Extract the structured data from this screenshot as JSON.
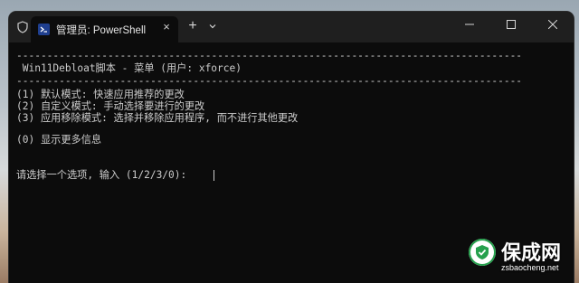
{
  "tab": {
    "title": "管理员: PowerShell",
    "close_icon": "×",
    "new_tab_icon": "+",
    "icon": "powershell-icon"
  },
  "window_controls": [
    "minimize-icon",
    "maximize-icon",
    "close-icon"
  ],
  "terminal": {
    "divider": "-----------------------------------------------------------------------------------",
    "menu_title": " Win11Debloat脚本 - 菜单 (用户: xforce)",
    "options": [
      "(1) 默认模式: 快速应用推荐的更改",
      "(2) 自定义模式: 手动选择要进行的更改",
      "(3) 应用移除模式: 选择并移除应用程序, 而不进行其他更改"
    ],
    "more_info": "(0) 显示更多信息",
    "prompt": "请选择一个选项, 输入 (1/2/3/0):"
  },
  "watermark": {
    "title": "保成网",
    "url": "zsbaocheng.net"
  },
  "colors": {
    "terminal_bg": "#0c0c0c",
    "titlebar_bg": "#1f1f1f",
    "text": "#cccccc",
    "brand_green": "#26a04d"
  }
}
